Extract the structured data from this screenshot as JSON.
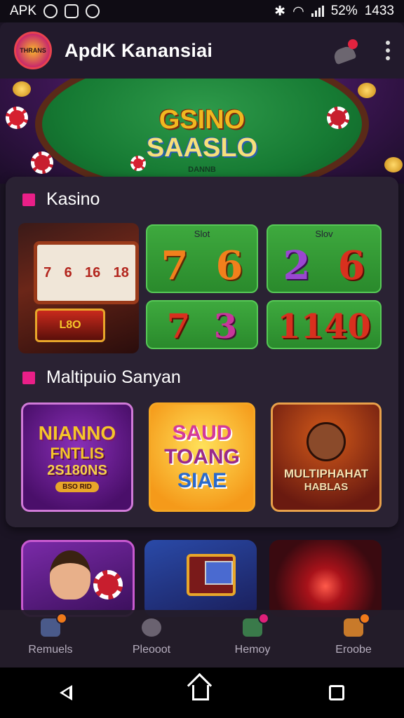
{
  "status_bar": {
    "left_text": "APK",
    "icons_left": [
      "shield-icon",
      "check-badge-icon",
      "camera-icon"
    ],
    "icons_right": [
      "bluetooth-icon",
      "wifi-icon",
      "signal-icon"
    ],
    "battery": "52%",
    "time": "1433"
  },
  "app_bar": {
    "logo_text": "THRANS",
    "title": "ApdK Kanansiai",
    "actions": [
      "user-alert-icon",
      "more-vert-icon"
    ]
  },
  "hero": {
    "title_line1": "GSINO",
    "title_line2": "SAASLO",
    "subtitle": "DANNB"
  },
  "section_kasino": {
    "heading": "Kasino",
    "slot_tiles": [
      {
        "label": "Slot",
        "numbers": [
          "7",
          "6"
        ],
        "colors": [
          "orange",
          "orange"
        ]
      },
      {
        "label": "Slov",
        "numbers": [
          "2",
          "6"
        ],
        "colors": [
          "purple",
          "red"
        ]
      },
      {
        "label": "",
        "numbers": [
          "7",
          "3"
        ],
        "colors": [
          "red",
          "magenta"
        ]
      },
      {
        "label": "",
        "numbers": [
          "1140"
        ],
        "colors": [
          "red"
        ]
      }
    ],
    "machine_reels": [
      "7",
      "6",
      "16",
      "18"
    ],
    "machine_base_text": "L8O"
  },
  "section_multiplayer": {
    "heading": "Maltipuio Sanyan",
    "games": [
      {
        "lines": [
          "NIANNO",
          "FNTLIS",
          "2S180NS"
        ],
        "tag": "BSO RID"
      },
      {
        "lines": [
          "SAUD",
          "TOANG",
          "SIAE"
        ]
      },
      {
        "lines": [
          "MULTIPHAHAT",
          "HABLAS"
        ]
      }
    ]
  },
  "bottom_nav": [
    {
      "label": "Remuels",
      "icon": "home-icon",
      "badge": true
    },
    {
      "label": "Pleooot",
      "icon": "gear-flower-icon",
      "badge": false
    },
    {
      "label": "Hemoy",
      "icon": "wallet-icon",
      "badge": true
    },
    {
      "label": "Eroobe",
      "icon": "trophy-icon",
      "badge": true
    }
  ],
  "colors": {
    "accent": "#ea1f88",
    "background": "#1b1424",
    "panel": "#2a2233",
    "badge": "#f07a1a"
  }
}
